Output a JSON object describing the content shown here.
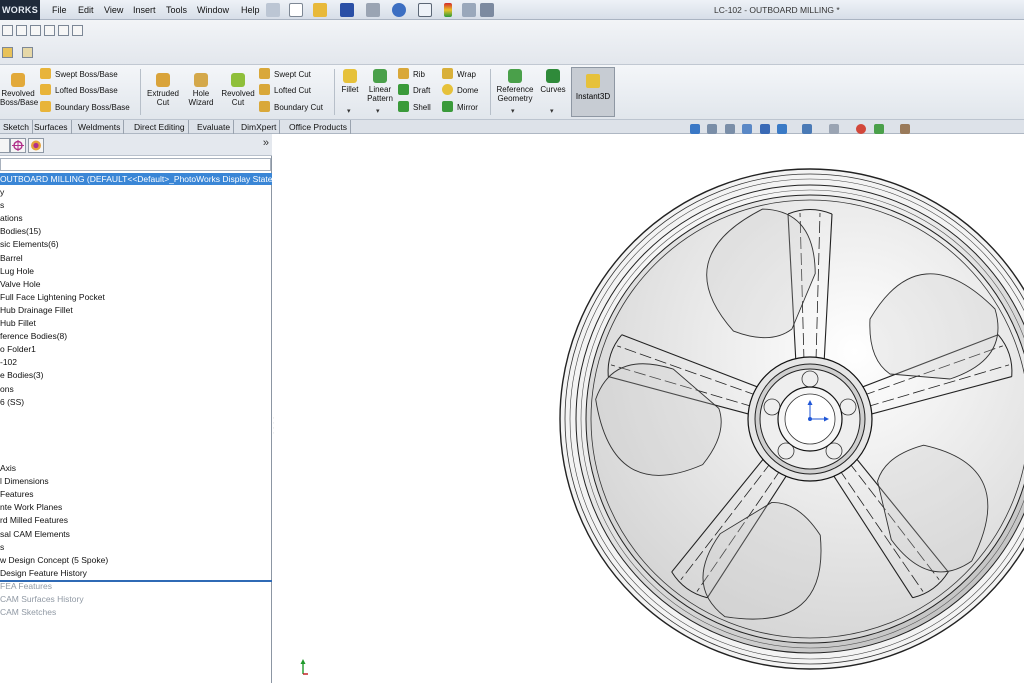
{
  "app": {
    "logo": "WORKS",
    "document_title": "LC-102 - OUTBOARD MILLING *"
  },
  "menu": [
    "File",
    "Edit",
    "View",
    "Insert",
    "Tools",
    "Window",
    "Help"
  ],
  "commands": {
    "revolved_boss": "Revolved\nBoss/Base",
    "swept_boss": "Swept Boss/Base",
    "lofted_boss": "Lofted Boss/Base",
    "boundary_boss": "Boundary Boss/Base",
    "extruded_cut": "Extruded\nCut",
    "hole_wizard": "Hole\nWizard",
    "revolved_cut": "Revolved\nCut",
    "swept_cut": "Swept Cut",
    "lofted_cut": "Lofted Cut",
    "boundary_cut": "Boundary Cut",
    "fillet": "Fillet",
    "linear_pattern": "Linear\nPattern",
    "rib": "Rib",
    "draft": "Draft",
    "shell": "Shell",
    "wrap": "Wrap",
    "dome": "Dome",
    "mirror": "Mirror",
    "reference_geometry": "Reference\nGeometry",
    "curves": "Curves",
    "instant3d": "Instant3D"
  },
  "tabs": [
    "Sketch",
    "Surfaces",
    "Weldments",
    "Direct Editing",
    "Evaluate",
    "DimXpert",
    "Office Products"
  ],
  "tree": {
    "root": "OUTBOARD MILLING  (DEFAULT<<Default>_PhotoWorks Display State>",
    "rows": [
      "y",
      "s",
      "ations",
      "Bodies(15)",
      "sic Elements(6)",
      " Barrel",
      " Lug Hole",
      " Valve Hole",
      " Full Face Lightening Pocket",
      " Hub Drainage Fillet",
      " Hub Fillet",
      "ference Bodies(8)",
      "o Folder1",
      "-102",
      "e Bodies(3)",
      "ons",
      "6 (SS)"
    ],
    "rows_lower": [
      " Axis",
      "l Dimensions",
      " Features",
      "nte Work Planes",
      "rd Milled Features",
      "sal CAM Elements",
      "s",
      "w Design Concept (5 Spoke)",
      " Design Feature History"
    ],
    "rows_suppressed": [
      " FEA Features",
      " CAM Surfaces History",
      " CAM Sketches"
    ]
  },
  "colors": {
    "selection": "#3a86d6",
    "rollback_bar": "#2f6ab5",
    "triad_y": "#1e9a2a",
    "triad_x": "#c0141a",
    "origin": "#1f56d6"
  }
}
